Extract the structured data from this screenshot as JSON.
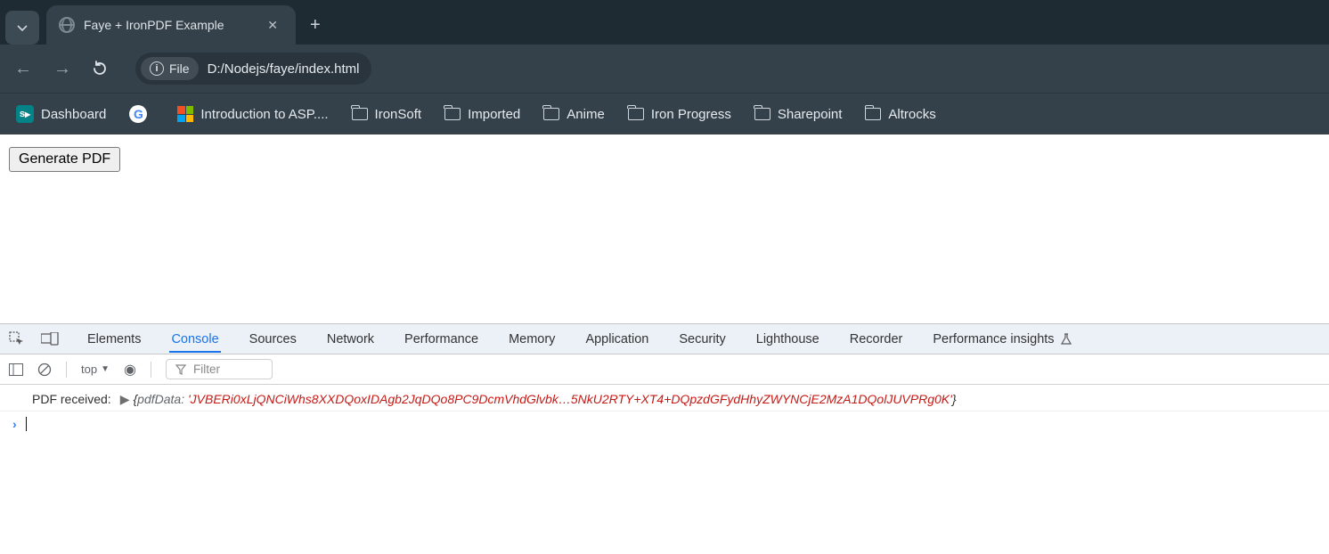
{
  "tab": {
    "title": "Faye + IronPDF Example"
  },
  "addressbar": {
    "protocol_label": "File",
    "url": "D:/Nodejs/faye/index.html"
  },
  "bookmarks": [
    {
      "label": "Dashboard",
      "icon": "sharepoint"
    },
    {
      "label": "",
      "icon": "google"
    },
    {
      "label": "Introduction to ASP....",
      "icon": "microsoft"
    },
    {
      "label": "IronSoft",
      "icon": "folder"
    },
    {
      "label": "Imported",
      "icon": "folder"
    },
    {
      "label": "Anime",
      "icon": "folder"
    },
    {
      "label": "Iron Progress",
      "icon": "folder"
    },
    {
      "label": "Sharepoint",
      "icon": "folder"
    },
    {
      "label": "Altrocks",
      "icon": "folder"
    }
  ],
  "page": {
    "button_label": "Generate PDF"
  },
  "devtools": {
    "tabs": [
      "Elements",
      "Console",
      "Sources",
      "Network",
      "Performance",
      "Memory",
      "Application",
      "Security",
      "Lighthouse",
      "Recorder",
      "Performance insights"
    ],
    "active_tab": "Console",
    "context": "top",
    "filter_placeholder": "Filter",
    "log": {
      "prefix": "PDF received:",
      "key": "pdfData:",
      "value": "'JVBERi0xLjQNCiWhs8XXDQoxIDAgb2JqDQo8PC9DcmVhdGlvbk…5NkU2RTY+XT4+DQpzdGFydHhyZWYNCjE2MzA1DQolJUVPRg0K'"
    }
  }
}
